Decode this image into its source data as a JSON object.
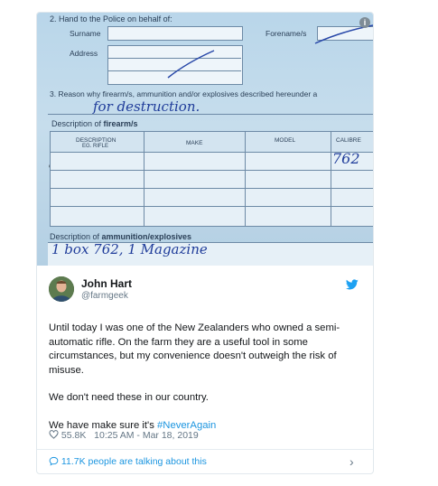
{
  "photo": {
    "section2_label": "2.   Hand to the Police on behalf of:",
    "surname_label": "Surname",
    "forename_label": "Forename/s",
    "address_label": "Address",
    "section3_label": "3.   Reason why firearm/s, ammunition and/or explosives described hereunder a",
    "reason_handwritten": "for destruction.",
    "firearm_desc_prefix": "Description of ",
    "firearm_desc_bold": "firearm/s",
    "col_description": "DESCRIPTION",
    "col_description_sub": "EG. RIFLE",
    "col_make": "MAKE",
    "col_model": "MODEL",
    "col_calibre": "CALIBRE",
    "calibre_handwritten": "762",
    "ammo_desc_prefix": "Description of ",
    "ammo_desc_bold": "ammunition/explosives",
    "ammo_handwritten": "1 box 762, 1 Magazine"
  },
  "tweet": {
    "name": "John Hart",
    "handle": "@farmgeek",
    "paragraph1": "Until today I was one of the New Zealanders who owned a semi-automatic rifle. On the farm they are a useful tool in some circumstances, but my convenience doesn't outweigh the risk of misuse.",
    "paragraph2": "We don't need these in our country.",
    "paragraph3_prefix": "We have make sure it's ",
    "hashtag": "#NeverAgain",
    "likes": "55.8K",
    "timestamp": "10:25 AM - Mar 18, 2019",
    "talking": "11.7K people are talking about this"
  },
  "colors": {
    "link": "#1b95e0",
    "muted": "#657786",
    "ink": "#1f3c9a"
  },
  "icons": [
    "info-icon",
    "twitter-bird-icon",
    "heart-icon",
    "comment-bubble-icon",
    "chevron-right-icon"
  ]
}
